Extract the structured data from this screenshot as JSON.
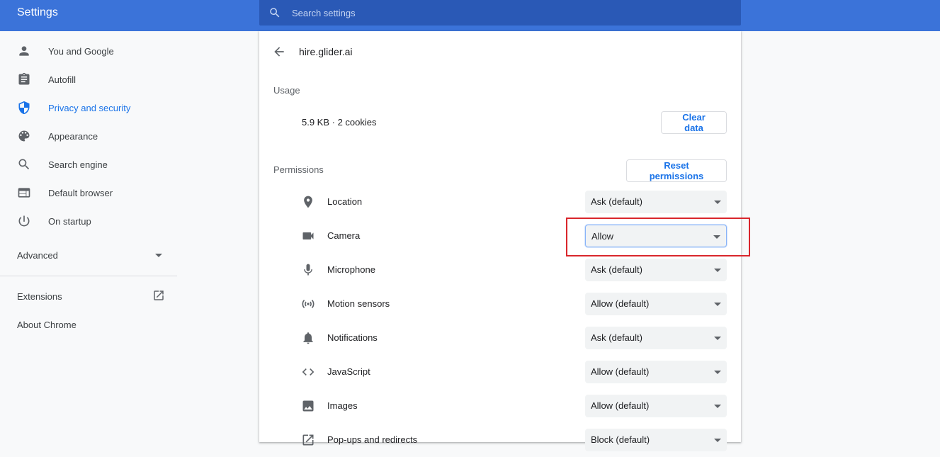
{
  "header": {
    "title": "Settings",
    "search_placeholder": "Search settings"
  },
  "sidebar": {
    "items": [
      {
        "label": "You and Google",
        "icon": "person-icon"
      },
      {
        "label": "Autofill",
        "icon": "clipboard-icon"
      },
      {
        "label": "Privacy and security",
        "icon": "shield-icon",
        "active": true
      },
      {
        "label": "Appearance",
        "icon": "palette-icon"
      },
      {
        "label": "Search engine",
        "icon": "search-icon"
      },
      {
        "label": "Default browser",
        "icon": "browser-icon"
      },
      {
        "label": "On startup",
        "icon": "power-icon"
      }
    ],
    "advanced_label": "Advanced",
    "extensions_label": "Extensions",
    "about_label": "About Chrome"
  },
  "site": {
    "title": "hire.glider.ai",
    "usage_heading": "Usage",
    "usage_text": "5.9 KB · 2 cookies",
    "clear_button": "Clear data",
    "permissions_heading": "Permissions",
    "reset_button": "Reset permissions"
  },
  "permissions": [
    {
      "label": "Location",
      "icon": "location-pin-icon",
      "value": "Ask (default)"
    },
    {
      "label": "Camera",
      "icon": "camera-icon",
      "value": "Allow"
    },
    {
      "label": "Microphone",
      "icon": "microphone-icon",
      "value": "Ask (default)"
    },
    {
      "label": "Motion sensors",
      "icon": "sensors-icon",
      "value": "Allow (default)"
    },
    {
      "label": "Notifications",
      "icon": "bell-icon",
      "value": "Ask (default)"
    },
    {
      "label": "JavaScript",
      "icon": "code-icon",
      "value": "Allow (default)"
    },
    {
      "label": "Images",
      "icon": "image-icon",
      "value": "Allow (default)"
    },
    {
      "label": "Pop-ups and redirects",
      "icon": "open-in-new-icon",
      "value": "Block (default)"
    }
  ],
  "colors": {
    "header": "#3b73d9",
    "search_bar": "#2a59b6",
    "accent": "#1a73e8",
    "highlight": "#d9262c"
  }
}
